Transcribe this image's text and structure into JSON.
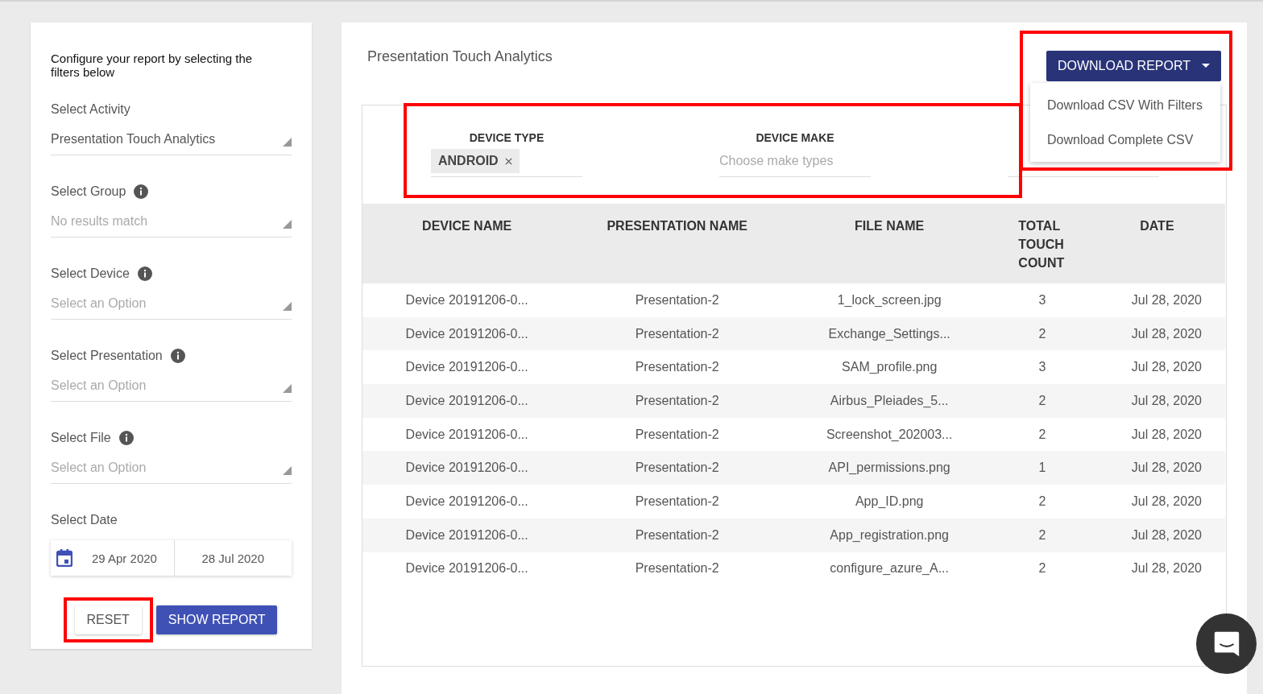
{
  "sidebar": {
    "intro": "Configure your report by selecting the filters below",
    "filters": [
      {
        "label": "Select Activity",
        "info": false,
        "value": "Presentation Touch Analytics"
      },
      {
        "label": "Select Group",
        "info": true,
        "placeholder": "No results match"
      },
      {
        "label": "Select Device",
        "info": true,
        "placeholder": "Select an Option"
      },
      {
        "label": "Select Presentation",
        "info": true,
        "placeholder": "Select an Option"
      },
      {
        "label": "Select File",
        "info": true,
        "placeholder": "Select an Option"
      }
    ],
    "date": {
      "label": "Select Date",
      "from": "29 Apr 2020",
      "to": "28 Jul 2020"
    },
    "buttons": [
      {
        "label": "RESET",
        "kind": "secondary",
        "highlighted": true
      },
      {
        "label": "SHOW REPORT",
        "kind": "primary",
        "highlighted": false
      }
    ]
  },
  "main": {
    "title": "Presentation Touch Analytics",
    "download": {
      "label": "DOWNLOAD REPORT",
      "expanded": true,
      "highlighted": true,
      "options": [
        "Download CSV With Filters",
        "Download Complete CSV"
      ]
    },
    "filter_bar": {
      "highlighted": true,
      "filters": [
        {
          "label": "DEVICE TYPE",
          "chips": [
            "ANDROID"
          ]
        },
        {
          "label": "DEVICE MAKE",
          "placeholder": "Choose make types"
        }
      ]
    },
    "table": {
      "columns": [
        "DEVICE NAME",
        "PRESENTATION NAME",
        "FILE NAME",
        "TOTAL TOUCH COUNT",
        "DATE"
      ],
      "rows": [
        [
          "Device 20191206-0...",
          "Presentation-2",
          "1_lock_screen.jpg",
          "3",
          "Jul 28, 2020"
        ],
        [
          "Device 20191206-0...",
          "Presentation-2",
          "Exchange_Settings...",
          "2",
          "Jul 28, 2020"
        ],
        [
          "Device 20191206-0...",
          "Presentation-2",
          "SAM_profile.png",
          "3",
          "Jul 28, 2020"
        ],
        [
          "Device 20191206-0...",
          "Presentation-2",
          "Airbus_Pleiades_5...",
          "2",
          "Jul 28, 2020"
        ],
        [
          "Device 20191206-0...",
          "Presentation-2",
          "Screenshot_202003...",
          "2",
          "Jul 28, 2020"
        ],
        [
          "Device 20191206-0...",
          "Presentation-2",
          "API_permissions.png",
          "1",
          "Jul 28, 2020"
        ],
        [
          "Device 20191206-0...",
          "Presentation-2",
          "App_ID.png",
          "2",
          "Jul 28, 2020"
        ],
        [
          "Device 20191206-0...",
          "Presentation-2",
          "App_registration.png",
          "2",
          "Jul 28, 2020"
        ],
        [
          "Device 20191206-0...",
          "Presentation-2",
          "configure_azure_A...",
          "2",
          "Jul 28, 2020"
        ]
      ]
    }
  }
}
